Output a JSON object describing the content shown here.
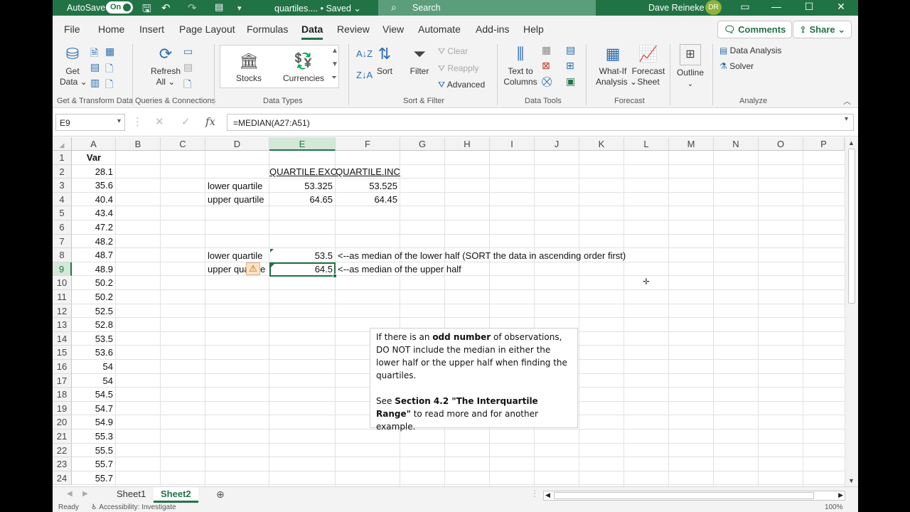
{
  "titlebar": {
    "autosave_label": "AutoSave",
    "autosave_state": "On",
    "file_title": "quartiles.... • Saved ⌄",
    "search_placeholder": "Search",
    "user_name": "Dave Reineke",
    "user_initials": "DR"
  },
  "tabs": [
    "File",
    "Home",
    "Insert",
    "Page Layout",
    "Formulas",
    "Data",
    "Review",
    "View",
    "Automate",
    "Add-ins",
    "Help"
  ],
  "active_tab": "Data",
  "top_buttons": {
    "comments": "Comments",
    "share": "Share"
  },
  "ribbon": {
    "get_data": "Get\nData ⌄",
    "refresh_all": "Refresh\nAll ⌄",
    "stocks": "Stocks",
    "currencies": "Currencies",
    "sort": "Sort",
    "filter": "Filter",
    "clear": "Clear",
    "reapply": "Reapply",
    "advanced": "Advanced",
    "text_to_columns": "Text to\nColumns",
    "what_if": "What-If\nAnalysis ⌄",
    "forecast_sheet": "Forecast\nSheet",
    "outline": "Outline",
    "data_analysis": "Data Analysis",
    "solver": "Solver",
    "groups": {
      "get_transform": "Get & Transform Data",
      "queries": "Queries & Connections",
      "data_types": "Data Types",
      "sort_filter": "Sort & Filter",
      "data_tools": "Data Tools",
      "forecast": "Forecast",
      "analyze": "Analyze"
    }
  },
  "formula_bar": {
    "name_box": "E9",
    "formula": "=MEDIAN(A27:A51)",
    "fx": "fx"
  },
  "columns": [
    "A",
    "B",
    "C",
    "D",
    "E",
    "F",
    "G",
    "H",
    "I",
    "J",
    "K",
    "L",
    "M",
    "N",
    "O",
    "P"
  ],
  "rows": [
    "1",
    "2",
    "3",
    "4",
    "5",
    "6",
    "7",
    "8",
    "9",
    "10",
    "11",
    "12",
    "13",
    "14",
    "15",
    "16",
    "17",
    "18",
    "19",
    "20",
    "21",
    "22",
    "23",
    "24"
  ],
  "col_a": [
    "Var",
    "28.1",
    "35.6",
    "40.4",
    "43.4",
    "47.2",
    "48.2",
    "48.7",
    "48.9",
    "50.2",
    "50.2",
    "52.5",
    "52.8",
    "53.5",
    "53.6",
    "54",
    "54",
    "54.5",
    "54.7",
    "54.9",
    "55.3",
    "55.5",
    "55.7",
    "55.7"
  ],
  "cells": {
    "e2": "QUARTILE.EXC",
    "f2": "QUARTILE.INC",
    "d3": "lower quartile",
    "e3": "53.325",
    "f3": "53.525",
    "d4": "upper quartile",
    "e4": "64.65",
    "f4": "64.45",
    "d8": "lower quartile",
    "e8": "53.5",
    "f8": "<--as median of the lower half (SORT the data in ascending order first)",
    "d9": "upper qua",
    "d9_end": "e",
    "e9": "64.5",
    "f9": "<--as median of the upper half"
  },
  "textbox": {
    "p1_a": "If there is an ",
    "p1_b": "odd number",
    "p1_c": " of observations, DO NOT include the median in either the lower half or the upper half when finding the quartiles.",
    "p2_a": "See ",
    "p2_b": "Section 4.2 \"The Interquartile Range\"",
    "p2_c": " to read more and for another example."
  },
  "sheets": [
    "Sheet1",
    "Sheet2"
  ],
  "active_sheet": "Sheet2",
  "status": {
    "ready": "Ready",
    "accessibility": "Accessibility: Investigate",
    "zoom": "100%"
  }
}
